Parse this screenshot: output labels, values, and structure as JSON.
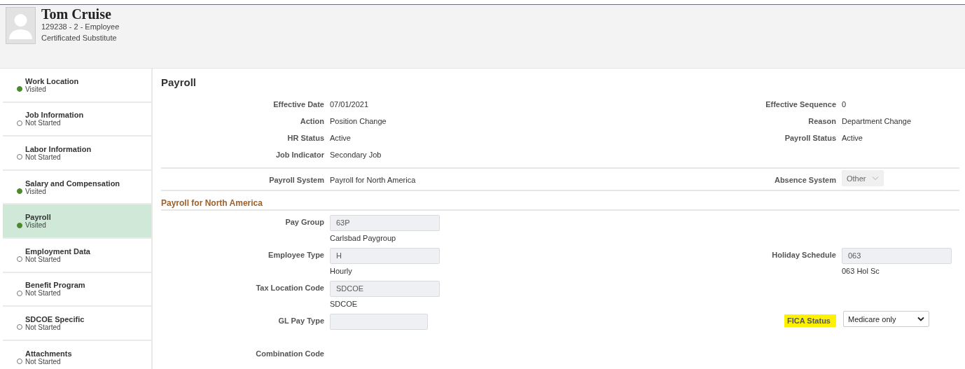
{
  "header": {
    "name": "Tom Cruise",
    "employee_line": "129238 - 2 - Employee",
    "job_title": "Certificated Substitute"
  },
  "sidebar": {
    "items": [
      {
        "label": "Work Location",
        "status": "Visited",
        "visited": true,
        "selected": false
      },
      {
        "label": "Job Information",
        "status": "Not Started",
        "visited": false,
        "selected": false
      },
      {
        "label": "Labor Information",
        "status": "Not Started",
        "visited": false,
        "selected": false
      },
      {
        "label": "Salary and Compensation",
        "status": "Visited",
        "visited": true,
        "selected": false
      },
      {
        "label": "Payroll",
        "status": "Visited",
        "visited": true,
        "selected": true
      },
      {
        "label": "Employment Data",
        "status": "Not Started",
        "visited": false,
        "selected": false
      },
      {
        "label": "Benefit Program",
        "status": "Not Started",
        "visited": false,
        "selected": false
      },
      {
        "label": "SDCOE Specific",
        "status": "Not Started",
        "visited": false,
        "selected": false
      },
      {
        "label": "Attachments",
        "status": "Not Started",
        "visited": false,
        "selected": false
      }
    ]
  },
  "page_title": "Payroll",
  "sections": [
    {
      "rows": [
        {
          "left": {
            "label": "Effective Date",
            "kind": "text",
            "value": "07/01/2021"
          },
          "right": {
            "label": "Effective Sequence",
            "kind": "text",
            "value": "0"
          }
        },
        {
          "left": {
            "label": "Action",
            "kind": "text",
            "value": "Position Change"
          },
          "right": {
            "label": "Reason",
            "kind": "text",
            "value": "Department Change"
          }
        },
        {
          "left": {
            "label": "HR Status",
            "kind": "text",
            "value": "Active"
          },
          "right": {
            "label": "Payroll Status",
            "kind": "text",
            "value": "Active"
          }
        },
        {
          "left": {
            "label": "Job Indicator",
            "kind": "text",
            "value": "Secondary Job"
          }
        }
      ]
    },
    {
      "rows": [
        {
          "left": {
            "label": "Payroll System",
            "kind": "text",
            "value": "Payroll for North America"
          },
          "right": {
            "label": "Absence System",
            "kind": "select",
            "value": "Other",
            "disabled": true,
            "highlighted": false
          }
        }
      ]
    },
    {
      "heading": "Payroll for North America",
      "rows": [
        {
          "left": {
            "label": "Pay Group",
            "kind": "input",
            "value": "63P",
            "description": "Carlsbad Paygroup"
          }
        },
        {
          "left": {
            "label": "Employee Type",
            "kind": "input",
            "value": "H",
            "description": "Hourly"
          },
          "right": {
            "label": "Holiday Schedule",
            "kind": "input",
            "value": "063",
            "description": "063 Hol Sc"
          }
        },
        {
          "left": {
            "label": "Tax Location Code",
            "kind": "input",
            "value": "SDCOE",
            "description": "SDCOE"
          }
        },
        {
          "left": {
            "label": "GL Pay Type",
            "kind": "input",
            "short": true
          },
          "right": {
            "label": "FICA Status",
            "kind": "select",
            "value": "Medicare only",
            "disabled": false,
            "highlighted": true
          }
        },
        {
          "left": {
            "label": "Combination Code",
            "kind": "text"
          }
        }
      ]
    }
  ]
}
